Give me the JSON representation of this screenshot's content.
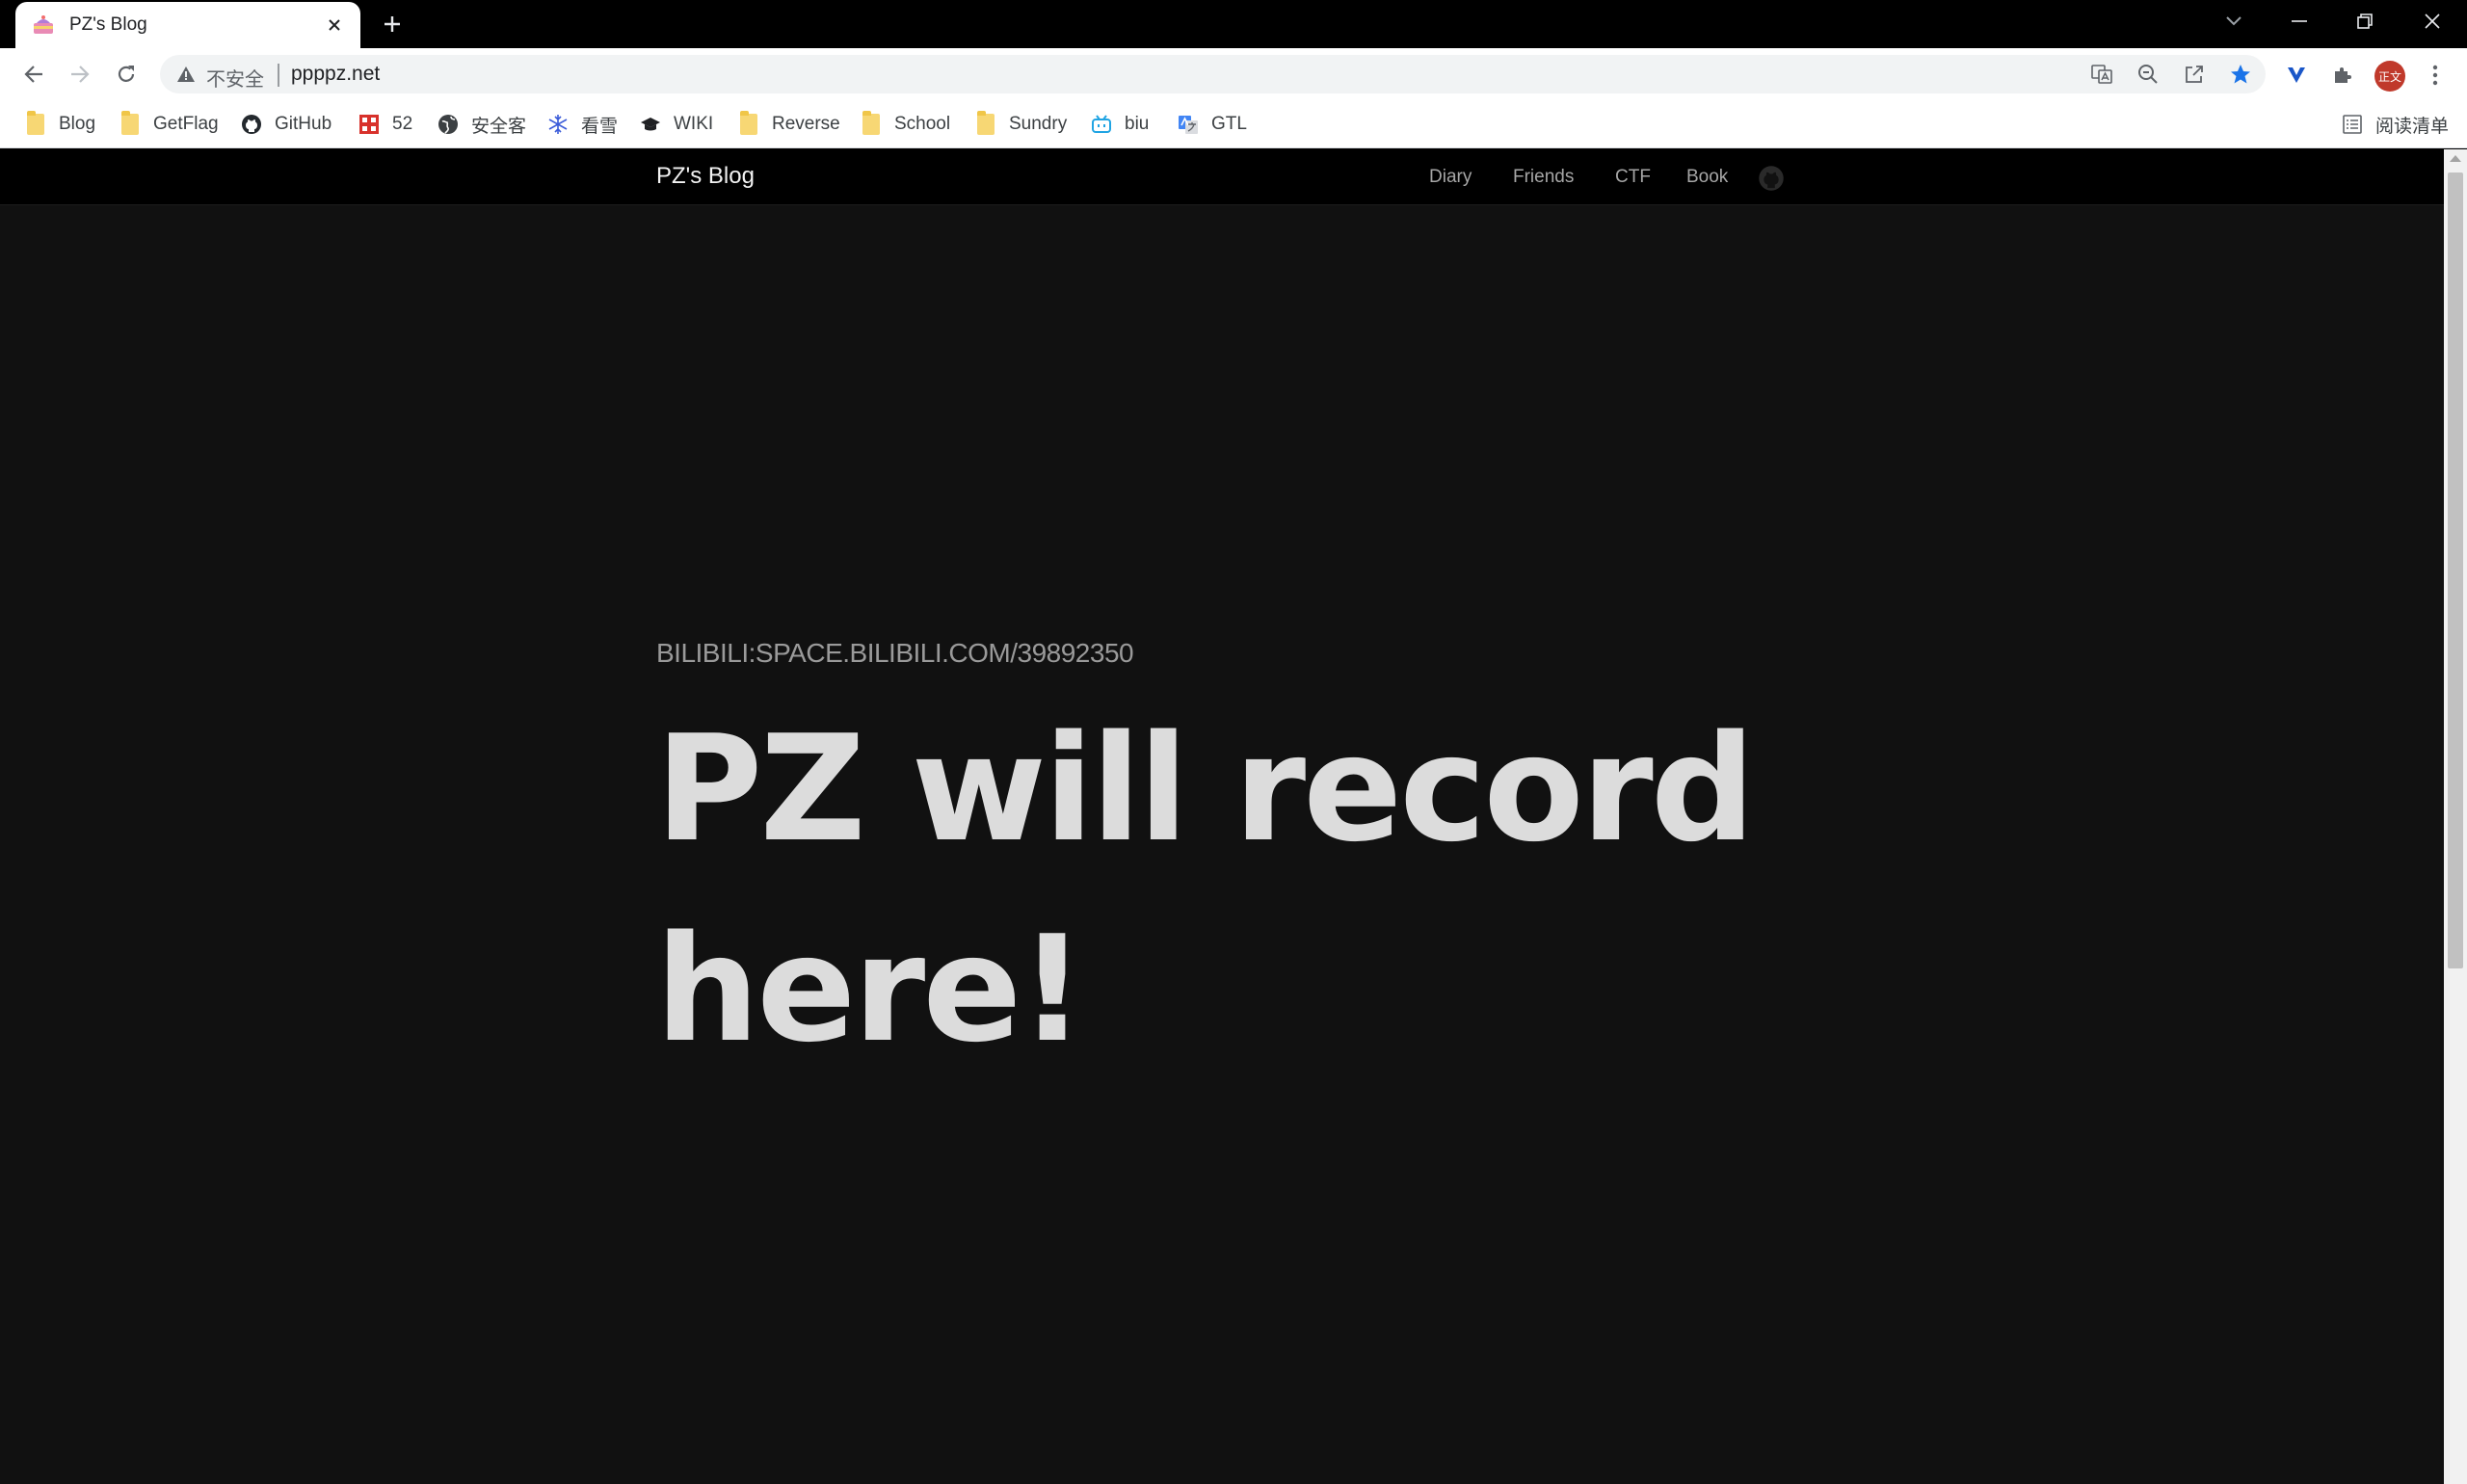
{
  "browser": {
    "tab": {
      "title": "PZ's Blog"
    },
    "address": {
      "security_label": "不安全",
      "url": "ppppz.net"
    },
    "profile_badge": "正文",
    "reading_list_label": "阅读清单"
  },
  "bookmarks": [
    {
      "label": "Blog",
      "icon": "folder-icon"
    },
    {
      "label": "GetFlag",
      "icon": "folder-icon"
    },
    {
      "label": "GitHub",
      "icon": "github-icon"
    },
    {
      "label": "52",
      "icon": "52pojie-icon"
    },
    {
      "label": "安全客",
      "icon": "globe-icon"
    },
    {
      "label": "看雪",
      "icon": "snowflake-icon"
    },
    {
      "label": "WIKI",
      "icon": "graduation-cap-icon"
    },
    {
      "label": "Reverse",
      "icon": "folder-icon"
    },
    {
      "label": "School",
      "icon": "folder-icon"
    },
    {
      "label": "Sundry",
      "icon": "folder-icon"
    },
    {
      "label": "biu",
      "icon": "bilibili-icon"
    },
    {
      "label": "GTL",
      "icon": "google-translate-icon"
    }
  ],
  "site": {
    "brand": "PZ's Blog",
    "nav": [
      "Diary",
      "Friends",
      "CTF",
      "Book"
    ],
    "subtitle": "BILIBILI:SPACE.BILIBILI.COM/39892350",
    "heading": "PZ will record here!"
  }
}
